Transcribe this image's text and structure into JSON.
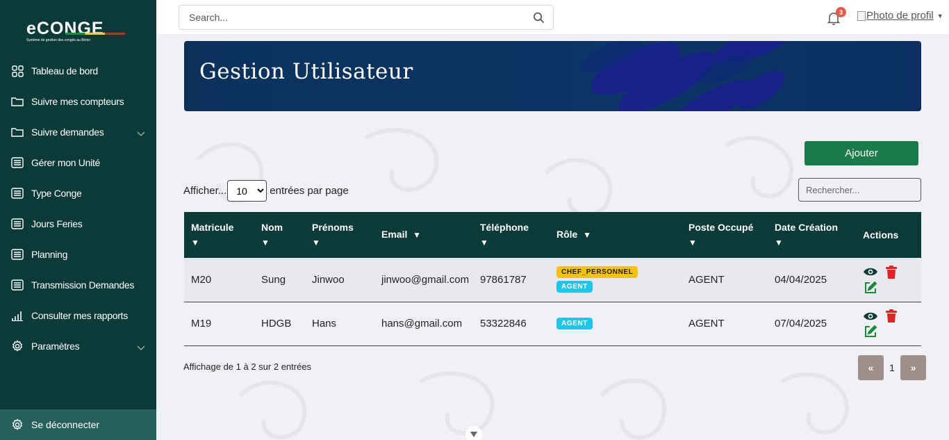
{
  "app": {
    "logo_title": "eCONGE",
    "logo_subtitle": "Système de gestion des congés au Bénin"
  },
  "sidebar": {
    "items": [
      {
        "label": "Tableau de bord",
        "icon": "grid-icon"
      },
      {
        "label": "Suivre mes compteurs",
        "icon": "folder-icon"
      },
      {
        "label": "Suivre demandes",
        "icon": "folder-icon",
        "has_submenu": true
      },
      {
        "label": "Gérer mon Unité",
        "icon": "list-icon"
      },
      {
        "label": "Type Conge",
        "icon": "list-icon"
      },
      {
        "label": "Jours Feries",
        "icon": "list-icon"
      },
      {
        "label": "Planning",
        "icon": "list-icon"
      },
      {
        "label": "Transmission Demandes",
        "icon": "list-icon"
      },
      {
        "label": "Consulter mes rapports",
        "icon": "bar-chart-icon"
      },
      {
        "label": "Paramètres",
        "icon": "gear-icon",
        "has_submenu": true
      }
    ],
    "logout_label": "Se déconnecter"
  },
  "topbar": {
    "search_placeholder": "Search...",
    "notification_count": "3",
    "profile_label": "Photo de profil"
  },
  "page": {
    "title": "Gestion Utilisateur",
    "add_button": "Ajouter",
    "show_prefix": "Afficher...",
    "page_size": "10",
    "page_size_options": [
      "10"
    ],
    "show_suffix": "entrées par page",
    "filter_placeholder": "Rechercher...",
    "info": "Affichage de 1 à 2 sur 2 entrées",
    "pager": {
      "prev": "«",
      "current": "1",
      "next": "»"
    }
  },
  "table": {
    "columns": [
      {
        "line1": "Matricule",
        "arrow": "▼"
      },
      {
        "line1": "Nom",
        "arrow": "▼"
      },
      {
        "line1": "Prénoms",
        "arrow": "▼"
      },
      {
        "line1": "Email",
        "arrow": "▼"
      },
      {
        "line1": "Téléphone",
        "arrow": "▼"
      },
      {
        "line1": "Rôle",
        "arrow": "▼"
      },
      {
        "line1": "Poste Occupé",
        "arrow": "▼"
      },
      {
        "line1": "Date Création",
        "arrow": "▼"
      },
      {
        "line1": "Actions",
        "arrow": ""
      }
    ],
    "rows": [
      {
        "matricule": "M20",
        "nom": "Sung",
        "prenoms": "Jinwoo",
        "email": "jinwoo@gmail.com",
        "telephone": "97861787",
        "roles": [
          "CHEF_PERSONNEL",
          "AGENT"
        ],
        "poste": "AGENT",
        "date": "04/04/2025"
      },
      {
        "matricule": "M19",
        "nom": "HDGB",
        "prenoms": "Hans",
        "email": "hans@gmail.com",
        "telephone": "53322846",
        "roles": [
          "AGENT"
        ],
        "poste": "AGENT",
        "date": "07/04/2025"
      }
    ]
  },
  "colors": {
    "sidebar_bg": "#0c3a38",
    "logout_bg": "#275f5f",
    "header_bg": "#0c3a38",
    "add_button": "#1b7a4a",
    "badge_chef": "#f5c211",
    "badge_agent": "#1cc7e8",
    "delete_icon": "#e02424",
    "edit_icon": "#1b8a3a",
    "view_icon": "#0c3a38"
  }
}
